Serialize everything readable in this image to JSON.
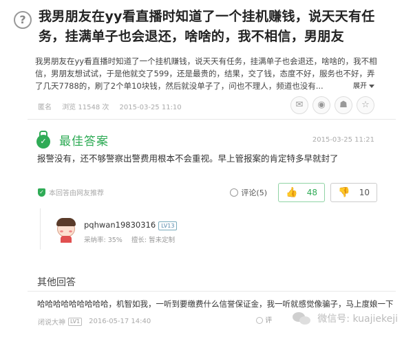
{
  "question": {
    "title": "我男朋友在yy看直播时知道了一个挂机赚钱，说天天有任务，挂满单子也会退还，啥啥的，我不相信，男朋友",
    "description": "我男朋友在yy看直播时知道了一个挂机赚钱，说天天有任务，挂满单子也会退还，啥啥的，我不相信，男朋友想试试，于是他就交了599，还是最贵的，结果，交了钱，态度不好，服务也不好，弄了几天7788的，刷了2个单10块钱，然后就没单子了，问也不理人，频道也没有...",
    "expand_label": "展开",
    "author": "匿名",
    "views": "浏览 11548 次",
    "time": "2015-03-25 11:10",
    "share_icons": [
      "wechat-icon",
      "weibo-icon",
      "qzone-icon",
      "star-icon"
    ]
  },
  "best_answer": {
    "heading": "最佳答案",
    "time": "2015-03-25 11:21",
    "text": "报警没有，还不够警察出警费用根本不会重视。早上管报案的肯定特多早就封了",
    "verified_label": "本回答由网友推荐",
    "comment_label": "评论(5)",
    "upvotes": "48",
    "downvotes": "10"
  },
  "answerer": {
    "name": "pqhwan19830316",
    "level": "LV13",
    "adoption_rate": "采纳率: 35%",
    "specialty": "擅长: 暂未定制"
  },
  "other_answers": {
    "heading": "其他回答",
    "text": "哈哈哈哈哈哈哈哈哈，机智如我，一听到要缴费什么信誉保证金，我一听就感觉像骗子，马上度娘一下",
    "author": "闭说大神",
    "level": "LV1",
    "time": "2016-05-17 14:40",
    "comment_label": "评"
  },
  "watermark": "微信号: kuajiekeji"
}
